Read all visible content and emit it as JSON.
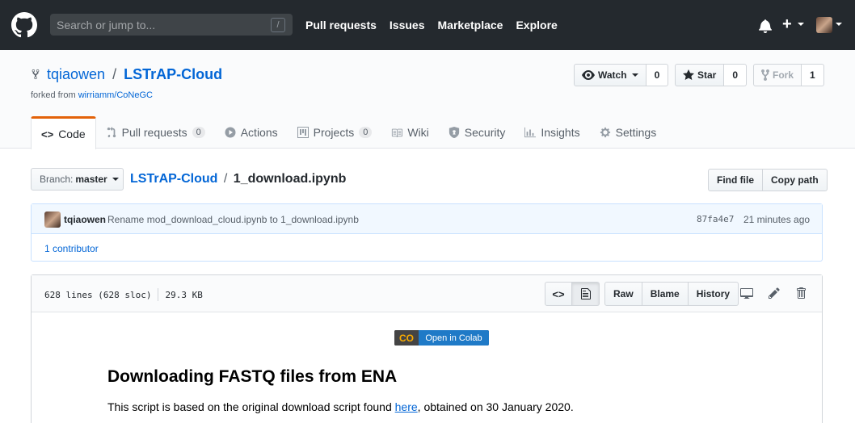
{
  "header": {
    "search_placeholder": "Search or jump to...",
    "search_key": "/",
    "nav": [
      "Pull requests",
      "Issues",
      "Marketplace",
      "Explore"
    ],
    "plus": "+"
  },
  "repo": {
    "owner": "tqiaowen",
    "separator": "/",
    "name": "LSTrAP-Cloud",
    "forked_prefix": "forked from",
    "forked_from": "wirriamm/CoNeGC",
    "watch_label": "Watch",
    "watch_count": "0",
    "star_label": "Star",
    "star_count": "0",
    "fork_label": "Fork",
    "fork_count": "1"
  },
  "tabs": [
    {
      "label": "Code",
      "count": ""
    },
    {
      "label": "Pull requests",
      "count": "0"
    },
    {
      "label": "Actions",
      "count": ""
    },
    {
      "label": "Projects",
      "count": "0"
    },
    {
      "label": "Wiki",
      "count": ""
    },
    {
      "label": "Security",
      "count": ""
    },
    {
      "label": "Insights",
      "count": ""
    },
    {
      "label": "Settings",
      "count": ""
    }
  ],
  "path": {
    "branch_label": "Branch:",
    "branch": "master",
    "root": "LSTrAP-Cloud",
    "separator": "/",
    "file": "1_download.ipynb",
    "find_file": "Find file",
    "copy_path": "Copy path"
  },
  "commit": {
    "author": "tqiaowen",
    "message": "Rename mod_download_cloud.ipynb to 1_download.ipynb",
    "sha": "87fa4e7",
    "time": "21 minutes ago",
    "contributors": "1 contributor"
  },
  "file": {
    "lines": "628 lines (628 sloc)",
    "size": "29.3 KB",
    "raw": "Raw",
    "blame": "Blame",
    "history": "History"
  },
  "notebook": {
    "colab_badge": "Open in Colab",
    "colab_logo": "CO",
    "heading": "Downloading FASTQ files from ENA",
    "text_before": "This script is based on the original download script found ",
    "link": "here",
    "text_after": ", obtained on 30 January 2020."
  },
  "colors": {
    "header_bg": "#24292e",
    "link": "#0366d6",
    "tab_accent": "#e36209"
  }
}
